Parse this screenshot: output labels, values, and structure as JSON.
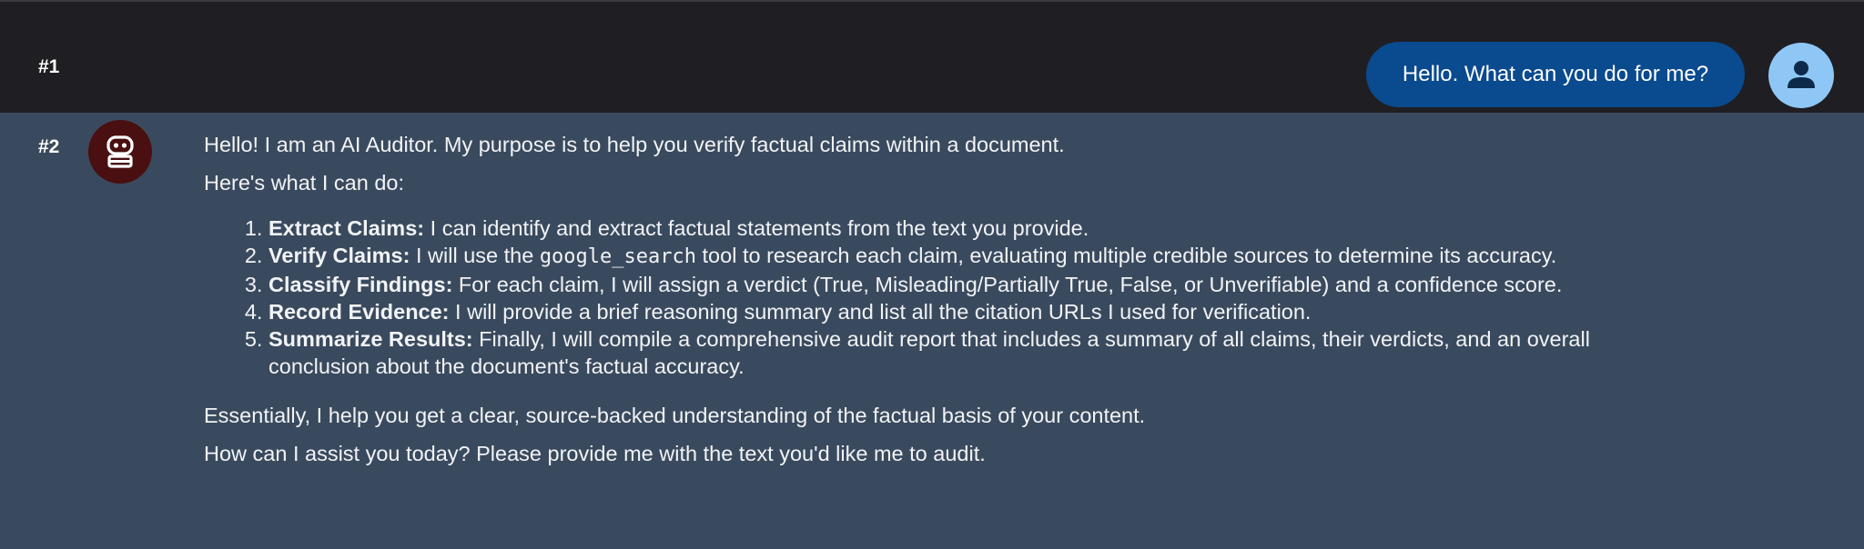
{
  "turns": {
    "user": {
      "number": "#1",
      "message": "Hello. What can you do for me?",
      "avatar_icon": "person-icon"
    },
    "assistant": {
      "number": "#2",
      "avatar_icon": "robot-icon",
      "intro": "Hello! I am an AI Auditor. My purpose is to help you verify factual claims within a document.",
      "lead": "Here's what I can do:",
      "steps": [
        {
          "title": "Extract Claims:",
          "text": " I can identify and extract factual statements from the text you provide."
        },
        {
          "title": "Verify Claims:",
          "text_before": " I will use the ",
          "code": "google_search",
          "text_after": " tool to research each claim, evaluating multiple credible sources to determine its accuracy."
        },
        {
          "title": "Classify Findings:",
          "text": " For each claim, I will assign a verdict (True, Misleading/Partially True, False, or Unverifiable) and a confidence score."
        },
        {
          "title": "Record Evidence:",
          "text": " I will provide a brief reasoning summary and list all the citation URLs I used for verification."
        },
        {
          "title": "Summarize Results:",
          "text": " Finally, I will compile a comprehensive audit report that includes a summary of all claims, their verdicts, and an overall conclusion about the document's factual accuracy."
        }
      ],
      "summary": "Essentially, I help you get a clear, source-backed understanding of the factual basis of your content.",
      "closing": "How can I assist you today? Please provide me with the text you'd like me to audit."
    }
  },
  "colors": {
    "user_bubble": "#0a4a8f",
    "user_avatar": "#8ec7f5",
    "assistant_background": "#3a4a5e",
    "bot_avatar": "#4a0f10"
  }
}
